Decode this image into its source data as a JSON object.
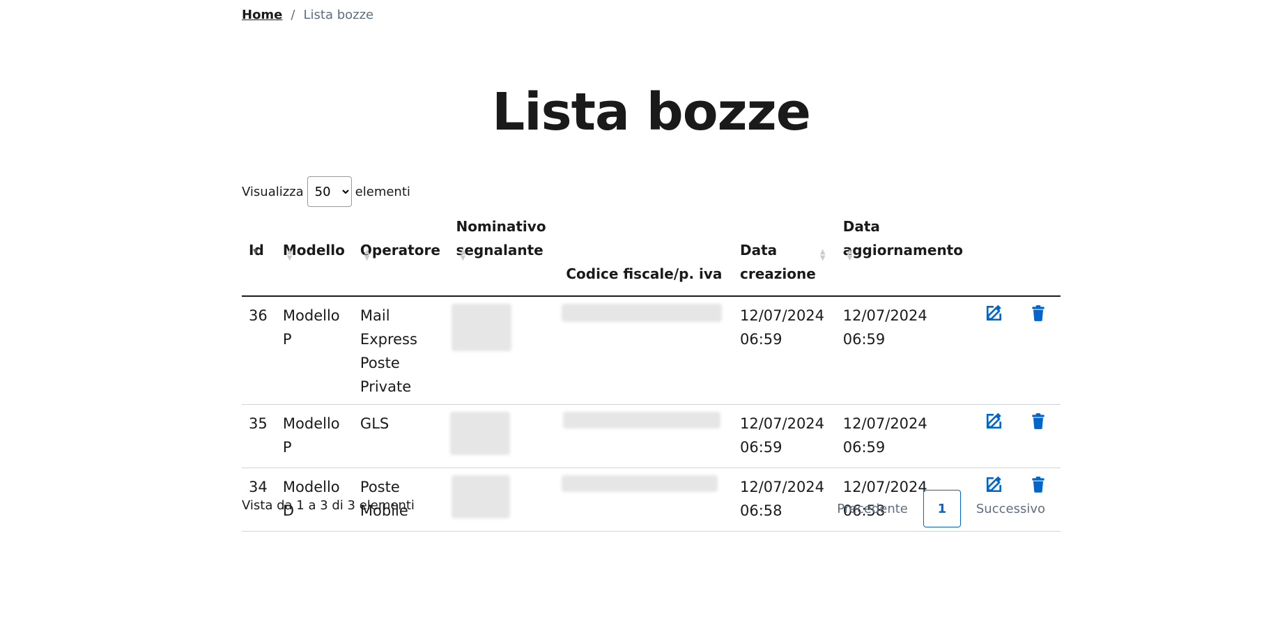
{
  "breadcrumb": {
    "home": "Home",
    "separator": "/",
    "current": "Lista bozze"
  },
  "title": "Lista bozze",
  "length": {
    "prefix": "Visualizza",
    "value": "50",
    "suffix": "elementi"
  },
  "table": {
    "headers": {
      "id": "Id",
      "modello": "Modello",
      "operatore": "Operatore",
      "nominativo_1": "Nominativo",
      "nominativo_2": "segnalante",
      "codice": "Codice fiscale/p. iva",
      "creazione_1": "Data",
      "creazione_2": "creazione",
      "aggiornamento_1": "Data",
      "aggiornamento_2": "aggiornamento"
    },
    "rows": [
      {
        "id": "36",
        "modello": "Modello P",
        "operatore_lines": [
          "Mail Express",
          "Poste",
          "Private"
        ],
        "creazione_date": "12/07/2024",
        "creazione_time": "06:59",
        "aggiornamento_date": "12/07/2024",
        "aggiornamento_time": "06:59"
      },
      {
        "id": "35",
        "modello": "Modello P",
        "operatore_lines": [
          "GLS"
        ],
        "creazione_date": "12/07/2024",
        "creazione_time": "06:59",
        "aggiornamento_date": "12/07/2024",
        "aggiornamento_time": "06:59"
      },
      {
        "id": "34",
        "modello": "Modello D",
        "operatore_lines": [
          "Poste",
          "Mobile"
        ],
        "creazione_date": "12/07/2024",
        "creazione_time": "06:58",
        "aggiornamento_date": "12/07/2024",
        "aggiornamento_time": "06:58"
      }
    ]
  },
  "info": "Vista da 1 a 3 di 3 elementi",
  "pager": {
    "previous": "Precedente",
    "current": "1",
    "next": "Successivo"
  },
  "icons": {
    "edit": "edit-icon",
    "delete": "trash-icon",
    "sort": "sort-icon"
  },
  "colors": {
    "accent": "#0066cc",
    "text": "#1a1a1a"
  }
}
